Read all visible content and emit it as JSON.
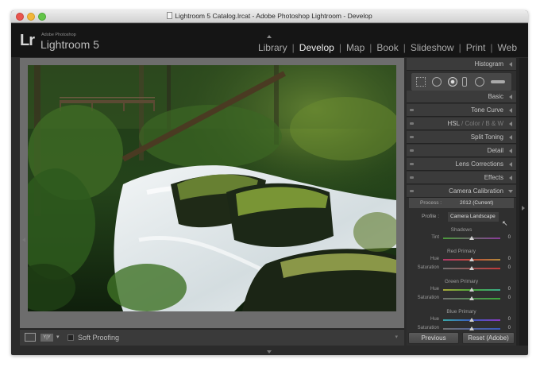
{
  "window": {
    "title": "Lightroom 5 Catalog.lrcat - Adobe Photoshop Lightroom - Develop"
  },
  "identity": {
    "logo": "Lr",
    "small": "Adobe Photoshop",
    "name": "Lightroom 5"
  },
  "modules": [
    "Library",
    "Develop",
    "Map",
    "Book",
    "Slideshow",
    "Print",
    "Web"
  ],
  "active_module": "Develop",
  "toolbar": {
    "soft_proofing": "Soft Proofing"
  },
  "panels": {
    "histogram": "Histogram",
    "basic": "Basic",
    "tone_curve": "Tone Curve",
    "hsl": "HSL",
    "color": "Color",
    "bw": "B & W",
    "split_toning": "Split Toning",
    "detail": "Detail",
    "lens_corrections": "Lens Corrections",
    "effects": "Effects",
    "camera_calibration": "Camera Calibration"
  },
  "calibration": {
    "process_label": "Process :",
    "process_value": "2012 (Current)",
    "profile_label": "Profile :",
    "profile_value": "Camera Landscape",
    "shadows": {
      "title": "Shadows",
      "tint_label": "Tint",
      "tint_value": "0"
    },
    "red": {
      "title": "Red Primary",
      "hue_label": "Hue",
      "hue_value": "0",
      "sat_label": "Saturation",
      "sat_value": "0"
    },
    "green": {
      "title": "Green Primary",
      "hue_label": "Hue",
      "hue_value": "0",
      "sat_label": "Saturation",
      "sat_value": "0"
    },
    "blue": {
      "title": "Blue Primary",
      "hue_label": "Hue",
      "hue_value": "0",
      "sat_label": "Saturation",
      "sat_value": "0"
    }
  },
  "buttons": {
    "previous": "Previous",
    "reset": "Reset (Adobe)"
  }
}
